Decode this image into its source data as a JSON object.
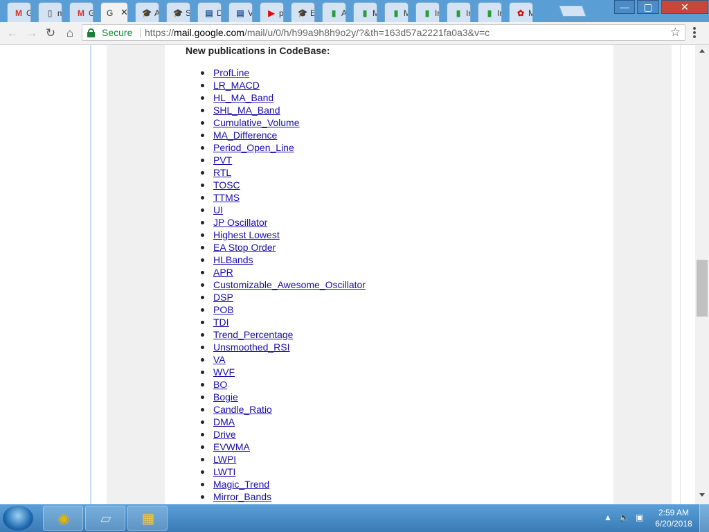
{
  "browser": {
    "tabs": [
      {
        "label": "G",
        "icon": "gmail-icon",
        "glyph": "M",
        "color": "#d93025"
      },
      {
        "label": "m",
        "icon": "document-icon",
        "glyph": "▯",
        "color": "#777"
      },
      {
        "label": "G",
        "icon": "gmail-icon",
        "glyph": "M",
        "color": "#d93025"
      },
      {
        "label": "G",
        "icon": "",
        "glyph": "",
        "color": "#333",
        "active": true
      },
      {
        "label": "A",
        "icon": "graduation-cap-icon",
        "glyph": "🎓",
        "color": "#2b5797"
      },
      {
        "label": "S",
        "icon": "graduation-cap-icon",
        "glyph": "🎓",
        "color": "#2b5797"
      },
      {
        "label": "D",
        "icon": "chart-icon",
        "glyph": "▤",
        "color": "#2b5797"
      },
      {
        "label": "V",
        "icon": "chart-icon",
        "glyph": "▤",
        "color": "#2b5797"
      },
      {
        "label": "p",
        "icon": "youtube-icon",
        "glyph": "▶",
        "color": "#e00"
      },
      {
        "label": "E",
        "icon": "graduation-cap-icon",
        "glyph": "🎓",
        "color": "#2b5797"
      },
      {
        "label": "A",
        "icon": "candlestick-icon",
        "glyph": "▮",
        "color": "#2a9d3a"
      },
      {
        "label": "M",
        "icon": "candlestick-icon",
        "glyph": "▮",
        "color": "#2a9d3a"
      },
      {
        "label": "M",
        "icon": "candlestick-icon",
        "glyph": "▮",
        "color": "#2a9d3a"
      },
      {
        "label": "Ir",
        "icon": "candlestick-icon",
        "glyph": "▮",
        "color": "#2a9d3a"
      },
      {
        "label": "Ir",
        "icon": "candlestick-icon",
        "glyph": "▮",
        "color": "#2a9d3a"
      },
      {
        "label": "Ir",
        "icon": "candlestick-icon",
        "glyph": "▮",
        "color": "#2a9d3a"
      },
      {
        "label": "M",
        "icon": "huawei-icon",
        "glyph": "✿",
        "color": "#d00"
      }
    ],
    "active_tab_close": "✕",
    "url_secure_label": "Secure",
    "url_scheme": "https://",
    "url_host": "mail.google.com",
    "url_path": "/mail/u/0/h/h99a9h8h9o2y/?&th=163d57a2221fa0a3&v=c",
    "accent_secure": "#188038"
  },
  "email": {
    "heading": "New publications in CodeBase:",
    "publications": [
      "ProfLine",
      "LR_MACD",
      "HL_MA_Band",
      "SHL_MA_Band",
      "Cumulative_Volume",
      "MA_Difference",
      "Period_Open_Line",
      "PVT",
      "RTL",
      "TOSC",
      "TTMS",
      "UI",
      "JP Oscillator",
      "Highest Lowest",
      "EA Stop Order",
      "HLBands",
      "APR",
      "Customizable_Awesome_Oscillator",
      "DSP",
      "POB",
      "TDI",
      "Trend_Percentage",
      "Unsmoothed_RSI",
      "VA",
      "WVF",
      "BO",
      "Bogie",
      "Candle_Ratio",
      "DMA",
      "Drive",
      "EVWMA",
      "LWPI",
      "LWTI",
      "Magic_Trend",
      "Mirror_Bands"
    ],
    "link_color": "#1a0dab"
  },
  "taskbar": {
    "apps": [
      {
        "name": "chrome-icon",
        "glyph": "◉"
      },
      {
        "name": "notepad-icon",
        "glyph": "▱"
      },
      {
        "name": "folder-icon",
        "glyph": "▦"
      }
    ],
    "time": "2:59 AM",
    "date": "6/20/2018"
  }
}
